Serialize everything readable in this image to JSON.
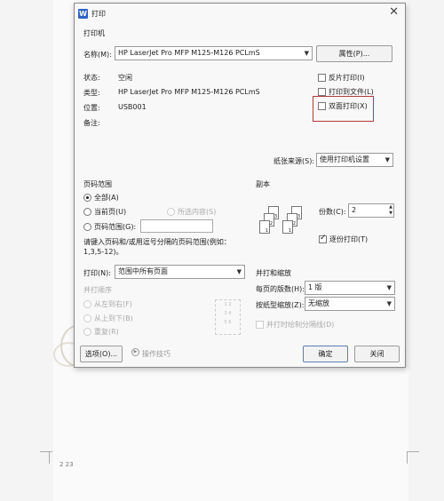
{
  "dialog": {
    "title": "打印",
    "icon": "W",
    "printer_section": "打印机",
    "name_label": "名称(M):",
    "printer_name": "HP LaserJet Pro MFP M125-M126 PCLmS",
    "properties_btn": "属性(P)...",
    "status_label": "状态:",
    "status_value": "空闲",
    "type_label": "类型:",
    "type_value": "HP LaserJet Pro MFP M125-M126 PCLmS",
    "location_label": "位置:",
    "location_value": "USB001",
    "comment_label": "备注:",
    "reverse_print": "反片打印(I)",
    "print_to_file": "打印到文件(L)",
    "duplex_print": "双面打印(X)",
    "paper_source_label": "纸张来源(S):",
    "paper_source_value": "使用打印机设置",
    "page_range_title": "页码范围",
    "all_pages": "全部(A)",
    "current_page": "当前页(U)",
    "selection": "所选内容(S)",
    "page_range": "页码范围(G):",
    "range_hint": "请键入页码和/或用逗号分隔的页码范围(例如：1,3,5-12)。",
    "copies_title": "副本",
    "copies_label": "份数(C):",
    "copies_value": "2",
    "collate": "逐份打印(T)",
    "print_label": "打印(N):",
    "print_value": "范围中所有页面",
    "print_order_title": "并打顺序",
    "order_left_right": "从左到右(F)",
    "order_top_bottom": "从上到下(B)",
    "order_repeat": "重复(R)",
    "zoom_title": "并打和缩放",
    "pages_per_sheet_label": "每页的版数(H):",
    "pages_per_sheet_value": "1 版",
    "scale_label": "按纸型缩放(Z):",
    "scale_value": "无缩放",
    "separator_line": "并打时绘制分隔线(D)",
    "options_btn": "选项(O)...",
    "tips": "操作技巧",
    "ok_btn": "确定",
    "close_btn": "关闭",
    "collate_sheets": [
      "1",
      "2",
      "3",
      "1",
      "2",
      "3"
    ],
    "order_preview": [
      "1",
      "2",
      "3",
      "4",
      "5",
      "6"
    ]
  },
  "background": {
    "page_number": "2 23"
  }
}
